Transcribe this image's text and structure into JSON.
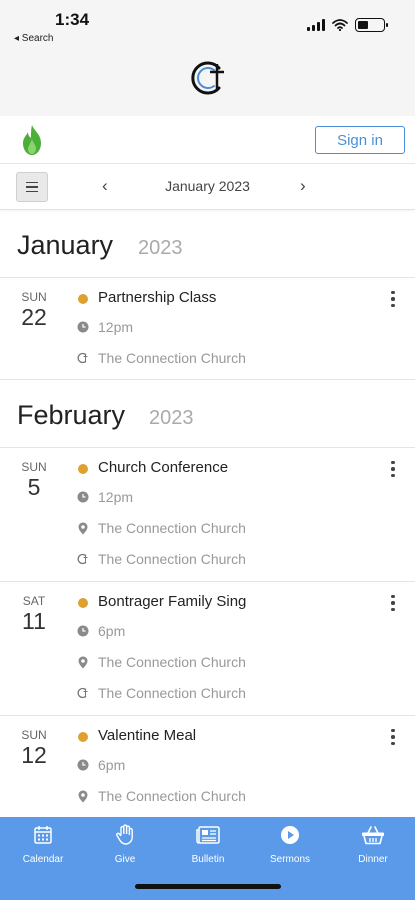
{
  "status": {
    "time": "1:34",
    "back_label": "◂ Search"
  },
  "auth": {
    "signin_label": "Sign in"
  },
  "nav": {
    "current_month": "January 2023"
  },
  "months": [
    {
      "name": "January",
      "year": "2023",
      "events": [
        {
          "dow": "SUN",
          "day": "22",
          "title": "Partnership Class",
          "time": "12pm",
          "location": null,
          "venue": "The Connection Church"
        }
      ]
    },
    {
      "name": "February",
      "year": "2023",
      "events": [
        {
          "dow": "SUN",
          "day": "5",
          "title": "Church Conference",
          "time": "12pm",
          "location": "The Connection Church",
          "venue": "The Connection Church"
        },
        {
          "dow": "SAT",
          "day": "11",
          "title": "Bontrager Family Sing",
          "time": "6pm",
          "location": "The Connection Church",
          "venue": "The Connection Church"
        },
        {
          "dow": "SUN",
          "day": "12",
          "title": "Valentine Meal",
          "time": "6pm",
          "location": "The Connection Church",
          "venue": null
        }
      ]
    }
  ],
  "tabs": [
    {
      "label": "Calendar",
      "icon": "calendar-icon"
    },
    {
      "label": "Give",
      "icon": "hand-icon"
    },
    {
      "label": "Bulletin",
      "icon": "newspaper-icon"
    },
    {
      "label": "Sermons",
      "icon": "play-icon"
    },
    {
      "label": "Dinner",
      "icon": "basket-icon"
    }
  ],
  "colors": {
    "accent": "#4a90d9",
    "tabbar": "#5a9ae8",
    "event_dot": "#e0a030",
    "flame": "#4caf3a"
  }
}
